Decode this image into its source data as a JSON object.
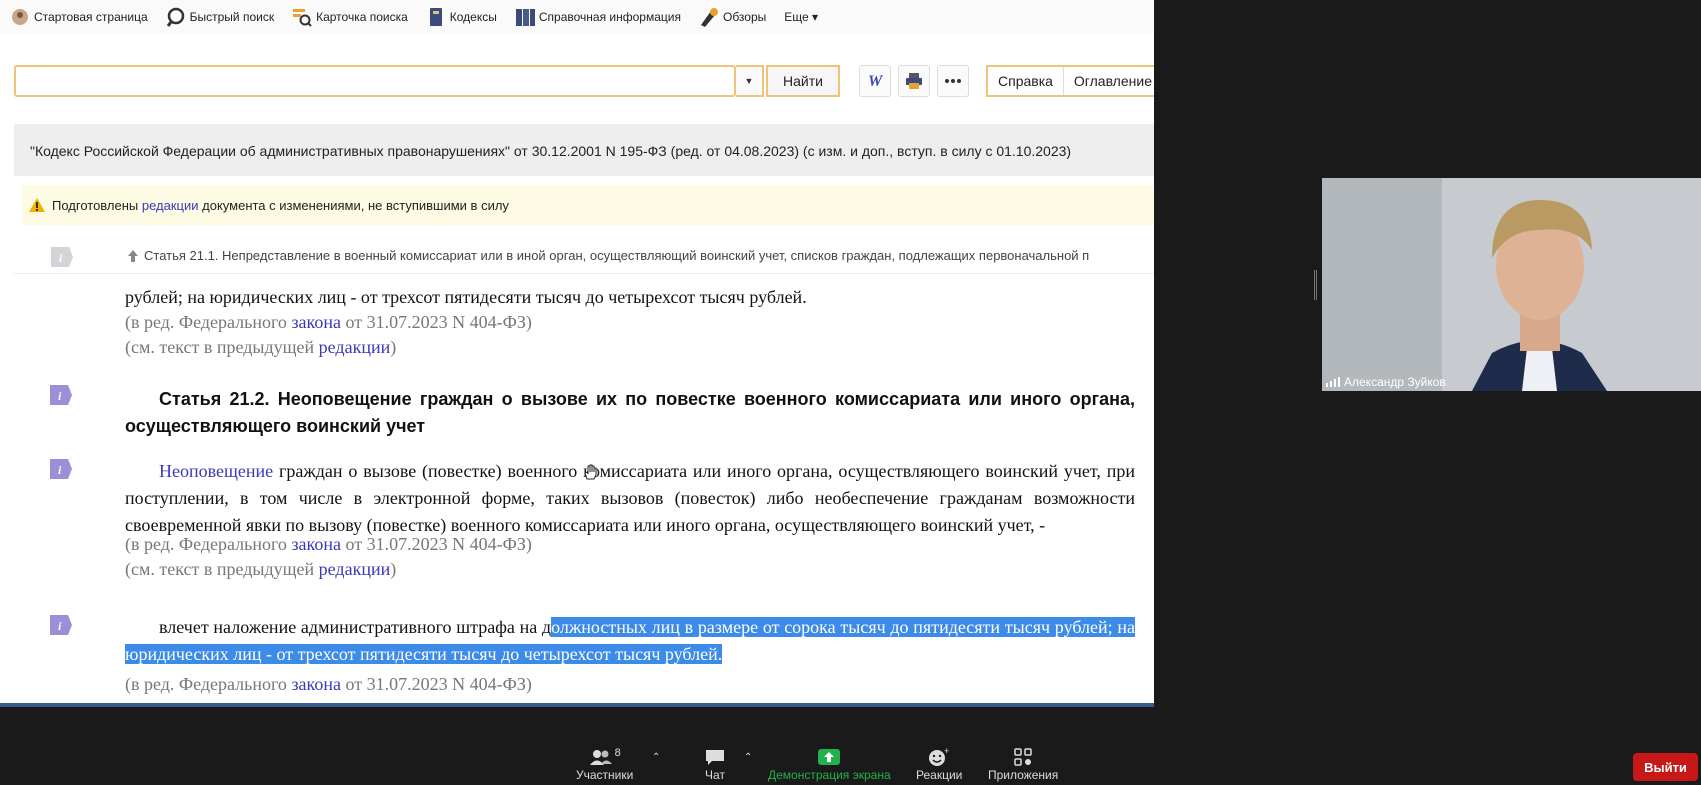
{
  "menu": {
    "items": [
      {
        "label": "Стартовая страница",
        "icon": "home-icon"
      },
      {
        "label": "Быстрый поиск",
        "icon": "magnifier-icon"
      },
      {
        "label": "Карточка поиска",
        "icon": "search-card-icon"
      },
      {
        "label": "Кодексы",
        "icon": "codex-book-icon"
      },
      {
        "label": "Справочная информация",
        "icon": "reference-books-icon"
      },
      {
        "label": "Обзоры",
        "icon": "reviews-icon"
      },
      {
        "label": "Еще ▾",
        "icon": ""
      }
    ]
  },
  "search": {
    "value": "",
    "placeholder": "",
    "find_label": "Найти"
  },
  "tabs": {
    "help": "Справка",
    "toc": "Оглавление"
  },
  "document": {
    "title": "\"Кодекс Российской Федерации об административных правонарушениях\" от 30.12.2001 N 195-ФЗ (ред. от 04.08.2023) (с изм. и доп., вступ. в силу с 01.10.2023)"
  },
  "warning": {
    "prefix": "Подготовлены ",
    "link": "редакции",
    "suffix": " документа с изменениями, не вступившими в силу"
  },
  "nav": {
    "prev_article": "Статья 21.1. Непредставление в военный комиссариат или в иной орган, осуществляющий воинский учет, списков граждан, подлежащих первоначальной п"
  },
  "content": {
    "para0": "рублей; на юридических лиц - от трехсот пятидесяти тысяч до четырехсот тысяч рублей.",
    "ed_prefix": "(в ред. Федерального ",
    "ed_link": "закона",
    "ed_suffix": " от 31.07.2023 N 404-ФЗ)",
    "prev_prefix": "(см. текст в предыдущей ",
    "prev_link": "редакции",
    "prev_suffix": ")",
    "heading": "Статья 21.2. Неоповещение граждан о вызове их по повестке военного комиссариата или иного органа, осуществляющего воинский учет",
    "para1_link": "Неоповещение",
    "para1_text": " граждан о вызове (повестке) военного комиссариата или иного органа, осуществляющего воинский учет, при поступлении, в том числе в электронной форме, таких вызовов (повесток) либо необеспечение гражданам возможности своевременной явки по вызову (повестке) военного комиссариата или иного органа, осуществляющего воинский учет, -",
    "para2_text": "влечет наложение административного штрафа на д",
    "para2_selected": "олжностных лиц в размере от сорока тысяч до пятидесяти тысяч рублей; на юридических лиц - от трехсот пятидесяти тысяч до четырехсот тысяч рублей."
  },
  "video": {
    "participant_name": "Александр Зуйков"
  },
  "zoom": {
    "participants_label": "Участники",
    "participants_count": "8",
    "chat_label": "Чат",
    "share_label": "Демонстрация экрана",
    "reactions_label": "Реакции",
    "apps_label": "Приложения",
    "exit_label": "Выйти"
  },
  "colors": {
    "accent_border": "#f0c27a",
    "link": "#3a3ab8",
    "selection": "#3d8be8",
    "share_green": "#22b14c",
    "exit_red": "#c71818"
  }
}
